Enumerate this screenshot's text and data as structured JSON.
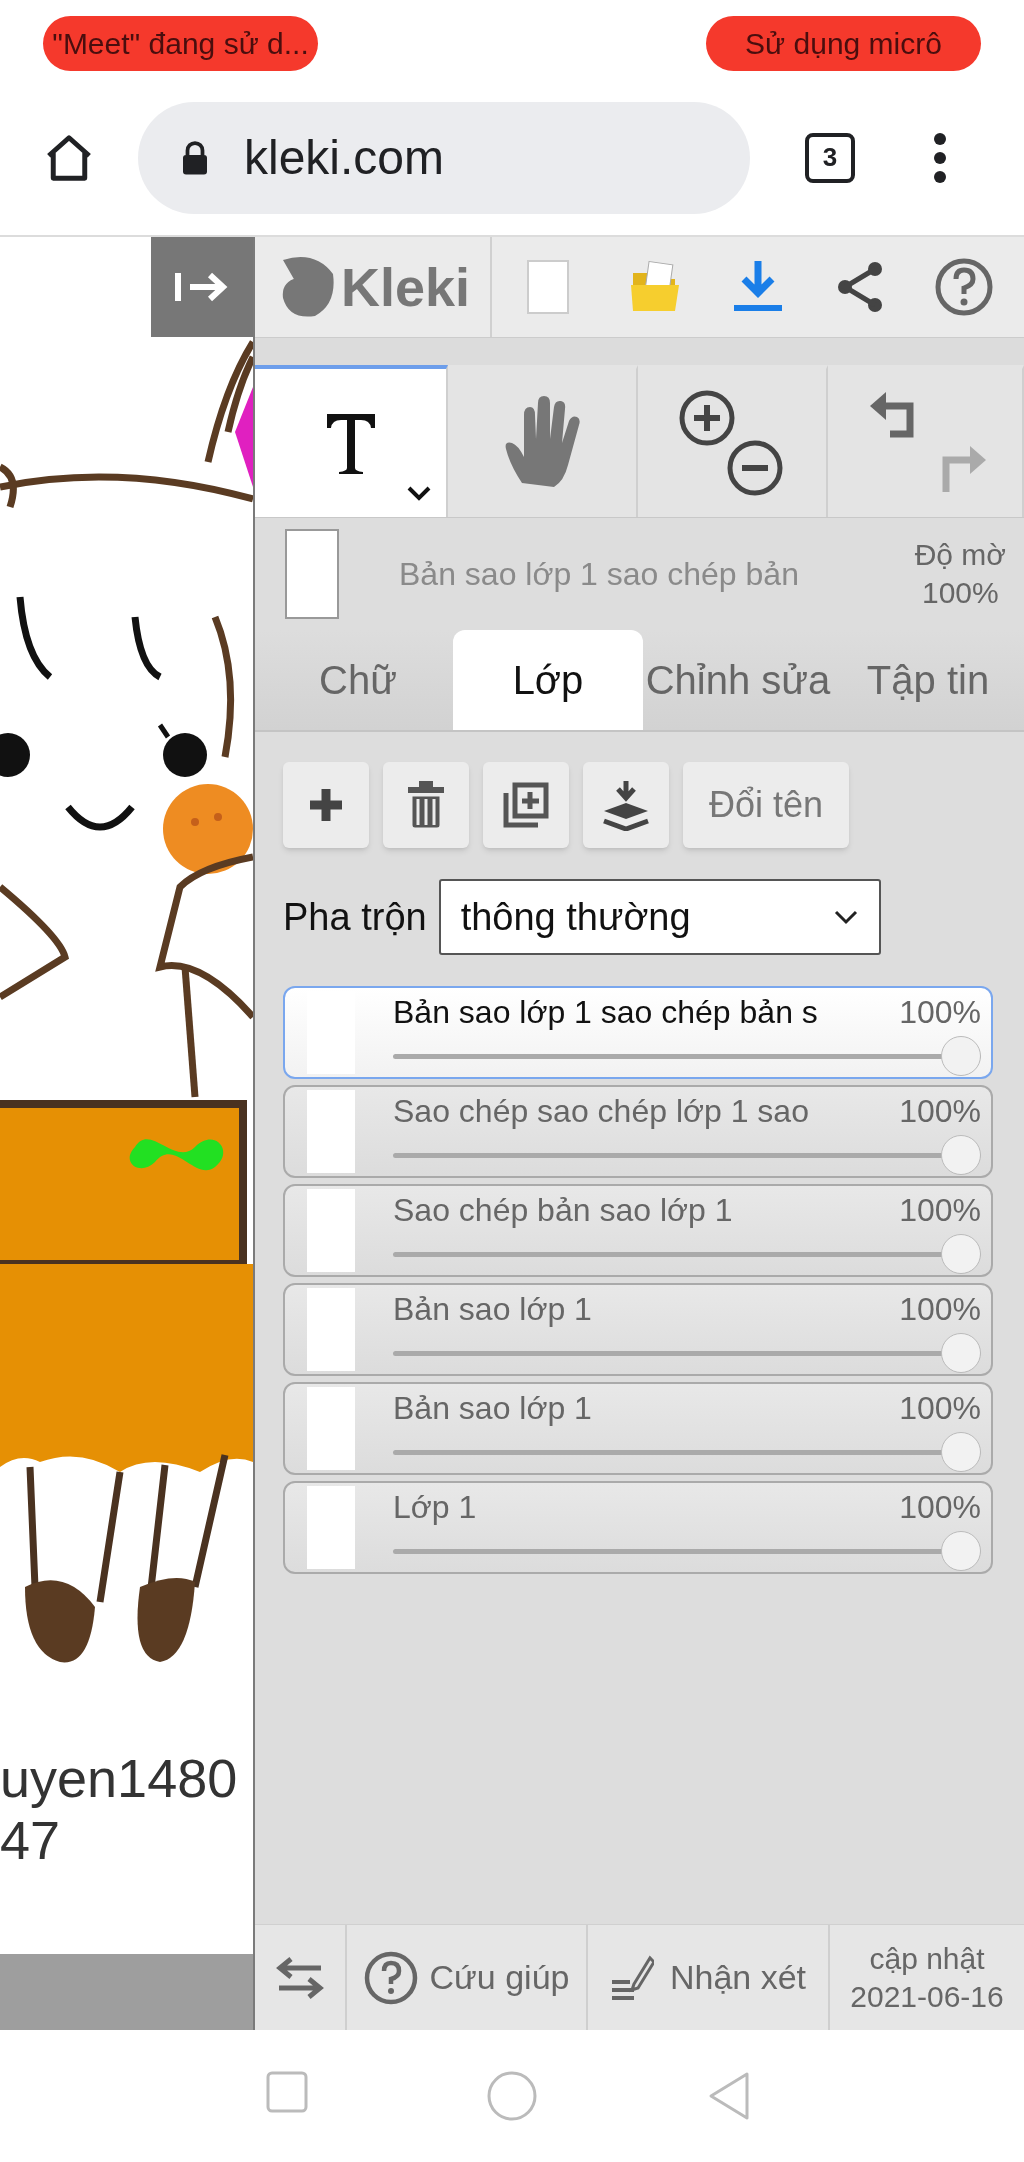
{
  "status_bar": {
    "left_pill": "\"Meet\" đang sử d...",
    "right_pill": "Sử dụng micrô"
  },
  "browser": {
    "url": "kleki.com",
    "tab_count": "3"
  },
  "canvas": {
    "text_lines": [
      "uyen1480",
      "47"
    ]
  },
  "header": {
    "logo": "Kleki"
  },
  "tools": [
    {
      "kind": "text",
      "selected": true
    },
    {
      "kind": "hand",
      "selected": false
    },
    {
      "kind": "zoom",
      "selected": false
    },
    {
      "kind": "history",
      "selected": false
    }
  ],
  "current_layer": {
    "name": "Bản sao lớp 1 sao chép bản",
    "opacity_label": "Độ mờ",
    "opacity_value": "100%"
  },
  "tabs": [
    {
      "label": "Chữ",
      "selected": false
    },
    {
      "label": "Lớp",
      "selected": true
    },
    {
      "label": "Chỉnh sửa",
      "selected": false
    },
    {
      "label": "Tập tin",
      "selected": false
    }
  ],
  "layer_buttons": [
    {
      "kind": "add"
    },
    {
      "kind": "delete"
    },
    {
      "kind": "duplicate"
    },
    {
      "kind": "merge"
    },
    {
      "kind": "rename",
      "label": "Đổi tên"
    }
  ],
  "blend": {
    "label": "Pha trộn",
    "value": "thông thường"
  },
  "layers": [
    {
      "name": "Bản sao lớp 1 sao chép bản s",
      "opacity": "100%",
      "level": 1,
      "selected": true
    },
    {
      "name": "Sao chép sao chép lớp 1 sao",
      "opacity": "100%",
      "level": 1,
      "selected": false
    },
    {
      "name": "Sao chép bản sao lớp 1",
      "opacity": "100%",
      "level": 1,
      "selected": false
    },
    {
      "name": "Bản sao lớp 1",
      "opacity": "100%",
      "level": 1,
      "selected": false
    },
    {
      "name": "Bản sao lớp 1",
      "opacity": "100%",
      "level": 1,
      "selected": false
    },
    {
      "name": "Lớp 1",
      "opacity": "100%",
      "level": 1,
      "selected": false
    }
  ],
  "bottom_bar": {
    "help": "Cứu giúp",
    "feedback": "Nhận xét",
    "update_label": "cập nhật",
    "update_date": "2021-06-16"
  }
}
